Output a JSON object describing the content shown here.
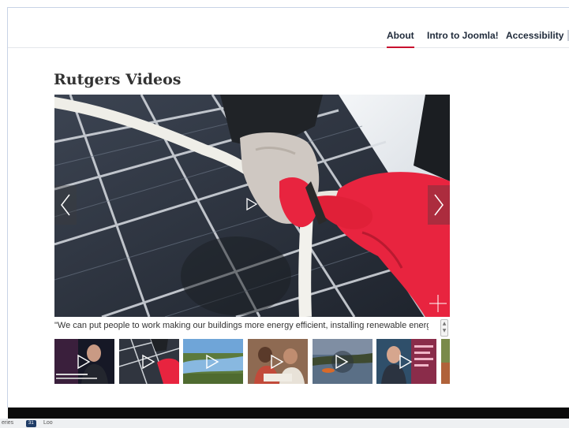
{
  "nav": {
    "items": [
      "About",
      "Intro to Joomla!",
      "Accessibility"
    ]
  },
  "page": {
    "title": "Rutgers Videos"
  },
  "player": {
    "caption": "\"We can put people to work making our buildings more energy efficient, installing renewable energy, and getting"
  },
  "statusbar": {
    "left_text": "eries",
    "badge": "31",
    "right_text": "Loo"
  },
  "colors": {
    "nav_active_underline": "#c8102e",
    "glove": "#e8243f",
    "nav_text": "#1f2a3a"
  }
}
